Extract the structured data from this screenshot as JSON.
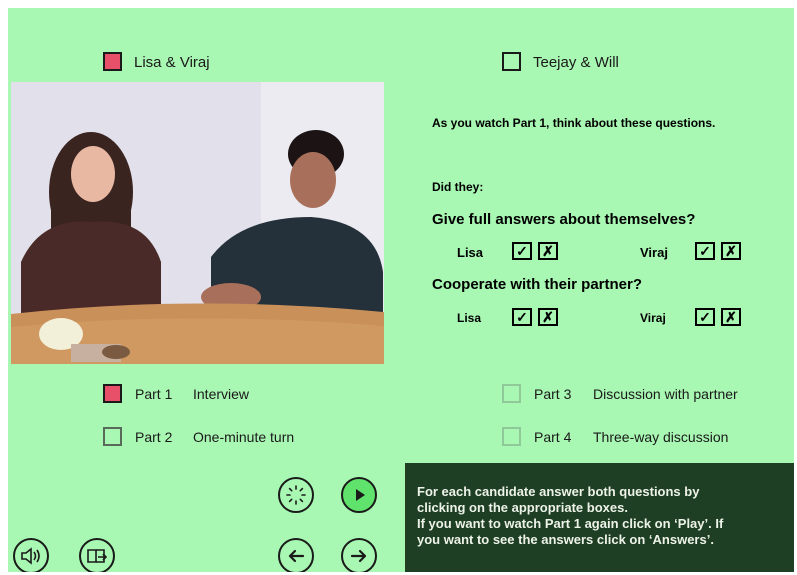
{
  "pairs": [
    {
      "label": "Lisa & Viraj",
      "selected": true
    },
    {
      "label": "Teejay & Will",
      "selected": false
    }
  ],
  "instruction": "As you watch Part 1, think about these questions.",
  "did_they": "Did they:",
  "questions": [
    {
      "text": "Give full answers about themselves?",
      "lisa": "Lisa",
      "viraj": "Viraj"
    },
    {
      "text": "Cooperate with their partner?",
      "lisa": "Lisa",
      "viraj": "Viraj"
    }
  ],
  "tick_glyph": "✓",
  "cross_glyph": "✗",
  "parts": [
    {
      "part": "Part 1",
      "name": "Interview",
      "selected": true
    },
    {
      "part": "Part 2",
      "name": "One-minute turn",
      "selected": false
    },
    {
      "part": "Part 3",
      "name": "Discussion with partner",
      "selected": false
    },
    {
      "part": "Part 4",
      "name": "Three-way discussion",
      "selected": false
    }
  ],
  "info_lines": [
    "For each candidate answer both questions by",
    "clicking on the appropriate boxes.",
    "If you want to watch Part 1 again click on ‘Play’. If",
    "you want to see the answers click on ‘Answers’."
  ],
  "colors": {
    "background": "#a8f7b2",
    "selected": "#e8506a",
    "info_panel": "#1e3f23",
    "play_button": "#5fe36c"
  },
  "icons": [
    "answers-icon",
    "play-icon",
    "volume-icon",
    "help-icon",
    "back-arrow-icon",
    "forward-arrow-icon"
  ]
}
